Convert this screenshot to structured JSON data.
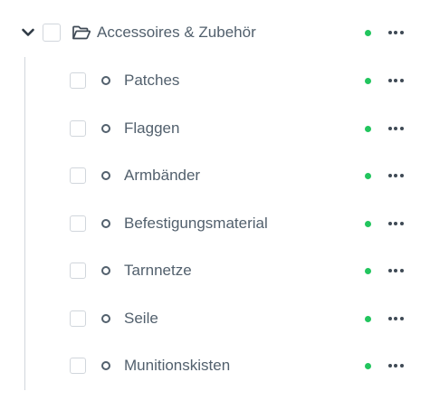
{
  "colors": {
    "status_active": "#22c55e",
    "text": "#52606d",
    "border": "#d1d6dc"
  },
  "parent": {
    "label": "Accessoires & Zubehör",
    "expanded": true,
    "icon": "folder-icon",
    "status": "active"
  },
  "children": [
    {
      "label": "Patches",
      "status": "active"
    },
    {
      "label": "Flaggen",
      "status": "active"
    },
    {
      "label": "Armbänder",
      "status": "active"
    },
    {
      "label": "Befestigungsmaterial",
      "status": "active"
    },
    {
      "label": "Tarnnetze",
      "status": "active"
    },
    {
      "label": "Seile",
      "status": "active"
    },
    {
      "label": "Munitionskisten",
      "status": "active"
    }
  ]
}
